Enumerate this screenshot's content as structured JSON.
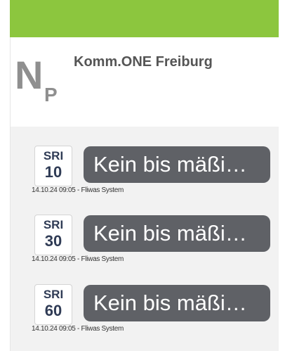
{
  "header": {
    "logo_big": "N",
    "logo_small": "P",
    "station_name": "Komm.ONE Freiburg"
  },
  "colors": {
    "top_bar": "#8cc63e",
    "bubble": "#5f6166",
    "badge_text": "#2f3b55"
  },
  "messages": [
    {
      "code": "SRI",
      "value": "10",
      "text": "Kein bis mäßi…",
      "meta": "14.10.24 09:05 - Fliwas System"
    },
    {
      "code": "SRI",
      "value": "30",
      "text": "Kein bis mäßi…",
      "meta": "14.10.24 09:05 - Fliwas System"
    },
    {
      "code": "SRI",
      "value": "60",
      "text": "Kein bis mäßi…",
      "meta": "14.10.24 09:05 - Fliwas System"
    }
  ]
}
